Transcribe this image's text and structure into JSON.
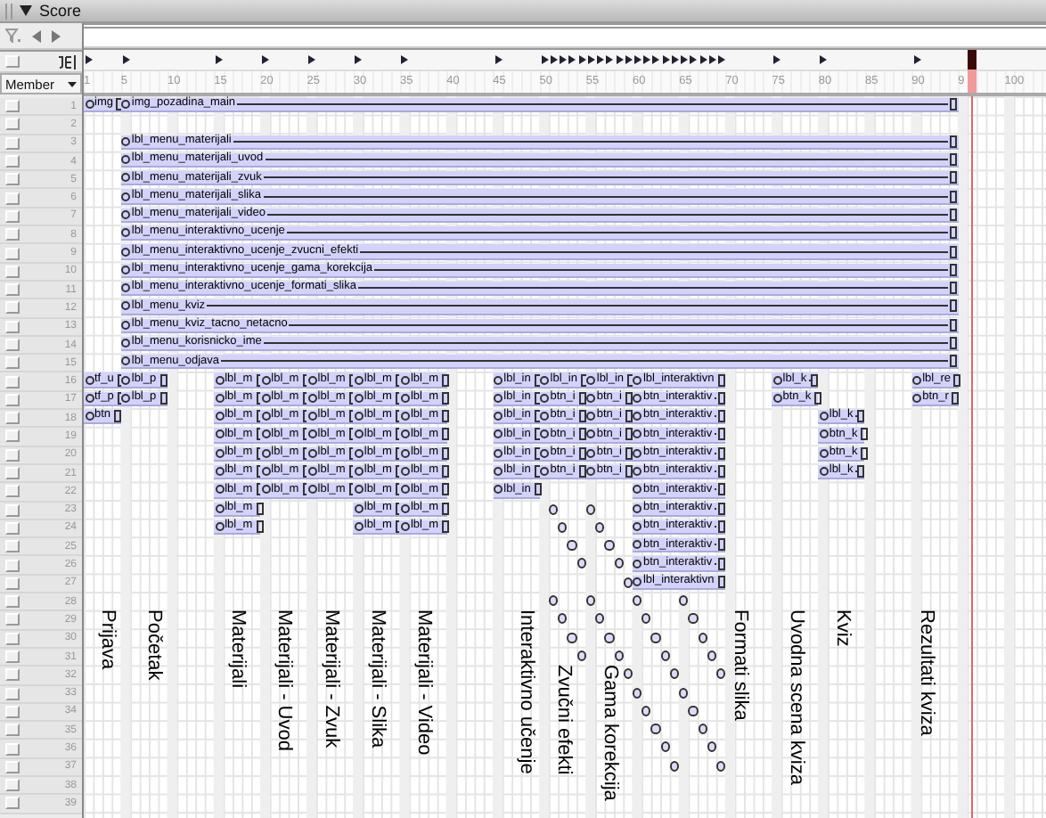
{
  "window": {
    "title": "Score"
  },
  "display_mode": "Member",
  "ruler": [
    "1",
    "5",
    "10",
    "15",
    "20",
    "25",
    "30",
    "35",
    "40",
    "45",
    "50",
    "55",
    "60",
    "65",
    "70",
    "75",
    "80",
    "85",
    "90",
    "9",
    "100"
  ],
  "channels": [
    {
      "number": "1",
      "sprites": [
        {
          "kind": "span",
          "label": "img"
        },
        {
          "kind": "span",
          "label": "img_pozadina_main"
        }
      ]
    },
    {
      "number": "2"
    },
    {
      "number": "3",
      "sprites": [
        {
          "kind": "span",
          "label": "lbl_menu_materijali"
        }
      ]
    },
    {
      "number": "4",
      "sprites": [
        {
          "kind": "span",
          "label": "lbl_menu_materijali_uvod"
        }
      ]
    },
    {
      "number": "5",
      "sprites": [
        {
          "kind": "span",
          "label": "lbl_menu_materijali_zvuk"
        }
      ]
    },
    {
      "number": "6",
      "sprites": [
        {
          "kind": "span",
          "label": "lbl_menu_materijali_slika"
        }
      ]
    },
    {
      "number": "7",
      "sprites": [
        {
          "kind": "span",
          "label": "lbl_menu_materijali_video"
        }
      ]
    },
    {
      "number": "8",
      "sprites": [
        {
          "kind": "span",
          "label": "lbl_menu_interaktivno_ucenje"
        }
      ]
    },
    {
      "number": "9",
      "sprites": [
        {
          "kind": "span",
          "label": "lbl_menu_interaktivno_ucenje_zvucni_efekti"
        }
      ]
    },
    {
      "number": "10",
      "sprites": [
        {
          "kind": "span",
          "label": "lbl_menu_interaktivno_ucenje_gama_korekcija"
        }
      ]
    },
    {
      "number": "11",
      "sprites": [
        {
          "kind": "span",
          "label": "lbl_menu_interaktivno_ucenje_formati_slika"
        }
      ]
    },
    {
      "number": "12",
      "sprites": [
        {
          "kind": "span",
          "label": "lbl_menu_kviz"
        }
      ]
    },
    {
      "number": "13",
      "sprites": [
        {
          "kind": "span",
          "label": "lbl_menu_kviz_tacno_netacno"
        }
      ]
    },
    {
      "number": "14",
      "sprites": [
        {
          "kind": "span",
          "label": "lbl_menu_korisnicko_ime"
        }
      ]
    },
    {
      "number": "15",
      "sprites": [
        {
          "kind": "span",
          "label": "lbl_menu_odjava"
        }
      ]
    },
    {
      "number": "16",
      "sprites": [
        {
          "kind": "span",
          "label": "tf_u"
        },
        {
          "kind": "span",
          "label": "lbl_p"
        },
        {
          "kind": "span",
          "label": "lbl_m"
        },
        {
          "kind": "span",
          "label": "lbl_m"
        },
        {
          "kind": "span",
          "label": "lbl_m"
        },
        {
          "kind": "span",
          "label": "lbl_m"
        },
        {
          "kind": "span",
          "label": "lbl_m"
        },
        {
          "kind": "span",
          "label": "lbl_in"
        },
        {
          "kind": "span",
          "label": "lbl_in"
        },
        {
          "kind": "span",
          "label": "lbl_in"
        },
        {
          "kind": "span",
          "label": "lbl_interaktivn"
        },
        {
          "kind": "span",
          "label": "lbl_k"
        },
        {
          "kind": "span",
          "label": "lbl_re"
        }
      ]
    },
    {
      "number": "17",
      "sprites": [
        {
          "kind": "span",
          "label": "tf_p"
        },
        {
          "kind": "span",
          "label": "lbl_p"
        },
        {
          "kind": "span",
          "label": "lbl_m"
        },
        {
          "kind": "span",
          "label": "lbl_m"
        },
        {
          "kind": "span",
          "label": "lbl_m"
        },
        {
          "kind": "span",
          "label": "lbl_m"
        },
        {
          "kind": "span",
          "label": "lbl_m"
        },
        {
          "kind": "span",
          "label": "lbl_in"
        },
        {
          "kind": "span",
          "label": "btn_i"
        },
        {
          "kind": "span",
          "label": "btn_i"
        },
        {
          "kind": "span",
          "label": "btn_interaktiv"
        },
        {
          "kind": "span",
          "label": "btn_k"
        },
        {
          "kind": "span",
          "label": "btn_r"
        }
      ]
    },
    {
      "number": "18",
      "sprites": [
        {
          "kind": "span",
          "label": "btn"
        },
        {
          "kind": "span",
          "label": "lbl_m"
        },
        {
          "kind": "span",
          "label": "lbl_m"
        },
        {
          "kind": "span",
          "label": "lbl_m"
        },
        {
          "kind": "span",
          "label": "lbl_m"
        },
        {
          "kind": "span",
          "label": "lbl_m"
        },
        {
          "kind": "span",
          "label": "lbl_in"
        },
        {
          "kind": "span",
          "label": "btn_i"
        },
        {
          "kind": "span",
          "label": "btn_i"
        },
        {
          "kind": "span",
          "label": "btn_interaktiv"
        },
        {
          "kind": "span",
          "label": "lbl_k"
        }
      ]
    },
    {
      "number": "19",
      "sprites": [
        {
          "kind": "span",
          "label": "lbl_m"
        },
        {
          "kind": "span",
          "label": "lbl_m"
        },
        {
          "kind": "span",
          "label": "lbl_m"
        },
        {
          "kind": "span",
          "label": "lbl_m"
        },
        {
          "kind": "span",
          "label": "lbl_m"
        },
        {
          "kind": "span",
          "label": "lbl_in"
        },
        {
          "kind": "span",
          "label": "btn_i"
        },
        {
          "kind": "span",
          "label": "btn_i"
        },
        {
          "kind": "span",
          "label": "btn_interaktiv"
        },
        {
          "kind": "span",
          "label": "btn_k"
        }
      ]
    },
    {
      "number": "20",
      "sprites": [
        {
          "kind": "span",
          "label": "lbl_m"
        },
        {
          "kind": "span",
          "label": "lbl_m"
        },
        {
          "kind": "span",
          "label": "lbl_m"
        },
        {
          "kind": "span",
          "label": "lbl_m"
        },
        {
          "kind": "span",
          "label": "lbl_m"
        },
        {
          "kind": "span",
          "label": "lbl_in"
        },
        {
          "kind": "span",
          "label": "btn_i"
        },
        {
          "kind": "span",
          "label": "btn_i"
        },
        {
          "kind": "span",
          "label": "btn_interaktiv"
        },
        {
          "kind": "span",
          "label": "btn_k"
        }
      ]
    },
    {
      "number": "21",
      "sprites": [
        {
          "kind": "span",
          "label": "lbl_m"
        },
        {
          "kind": "span",
          "label": "lbl_m"
        },
        {
          "kind": "span",
          "label": "lbl_m"
        },
        {
          "kind": "span",
          "label": "lbl_m"
        },
        {
          "kind": "span",
          "label": "lbl_m"
        },
        {
          "kind": "span",
          "label": "lbl_in"
        },
        {
          "kind": "span",
          "label": "btn_i"
        },
        {
          "kind": "span",
          "label": "btn_i"
        },
        {
          "kind": "span",
          "label": "btn_interaktiv"
        },
        {
          "kind": "span",
          "label": "lbl_k"
        }
      ]
    },
    {
      "number": "22",
      "sprites": [
        {
          "kind": "span",
          "label": "lbl_m"
        },
        {
          "kind": "span",
          "label": "lbl_m"
        },
        {
          "kind": "span",
          "label": "lbl_m"
        },
        {
          "kind": "span",
          "label": "lbl_m"
        },
        {
          "kind": "span",
          "label": "lbl_m"
        },
        {
          "kind": "span",
          "label": "lbl_in"
        },
        {
          "kind": "span",
          "label": "btn_interaktiv"
        }
      ]
    },
    {
      "number": "23",
      "sprites": [
        {
          "kind": "span",
          "label": "lbl_m"
        },
        {
          "kind": "span",
          "label": "lbl_m"
        },
        {
          "kind": "span",
          "label": "lbl_m"
        },
        {
          "kind": "dot"
        },
        {
          "kind": "dot"
        },
        {
          "kind": "span",
          "label": "btn_interaktiv"
        }
      ]
    },
    {
      "number": "24",
      "sprites": [
        {
          "kind": "span",
          "label": "lbl_m"
        },
        {
          "kind": "span",
          "label": "lbl_m"
        },
        {
          "kind": "span",
          "label": "lbl_m"
        },
        {
          "kind": "dot"
        },
        {
          "kind": "dot"
        },
        {
          "kind": "span",
          "label": "btn_interaktiv"
        }
      ]
    },
    {
      "number": "25",
      "sprites": [
        {
          "kind": "dot"
        },
        {
          "kind": "dot"
        },
        {
          "kind": "span",
          "label": "btn_interaktiv"
        }
      ]
    },
    {
      "number": "26",
      "sprites": [
        {
          "kind": "dot"
        },
        {
          "kind": "dot"
        },
        {
          "kind": "span",
          "label": "btn_interaktiv"
        }
      ]
    },
    {
      "number": "27",
      "sprites": [
        {
          "kind": "dot"
        },
        {
          "kind": "span",
          "label": "lbl_interaktivn"
        }
      ]
    },
    {
      "number": "28",
      "sprites": [
        {
          "kind": "dot"
        },
        {
          "kind": "dot"
        },
        {
          "kind": "dot"
        },
        {
          "kind": "dot"
        }
      ]
    },
    {
      "number": "29",
      "sprites": [
        {
          "kind": "dot"
        },
        {
          "kind": "dot"
        },
        {
          "kind": "dot"
        },
        {
          "kind": "dot"
        }
      ]
    },
    {
      "number": "30",
      "sprites": [
        {
          "kind": "dot"
        },
        {
          "kind": "dot"
        },
        {
          "kind": "dot"
        },
        {
          "kind": "dot"
        }
      ]
    },
    {
      "number": "31",
      "sprites": [
        {
          "kind": "dot"
        },
        {
          "kind": "dot"
        },
        {
          "kind": "dot"
        },
        {
          "kind": "dot"
        }
      ]
    },
    {
      "number": "32",
      "sprites": [
        {
          "kind": "dot"
        },
        {
          "kind": "dot"
        },
        {
          "kind": "dot"
        }
      ]
    },
    {
      "number": "33",
      "sprites": [
        {
          "kind": "dot"
        },
        {
          "kind": "dot"
        }
      ]
    },
    {
      "number": "34",
      "sprites": [
        {
          "kind": "dot"
        },
        {
          "kind": "dot"
        }
      ]
    },
    {
      "number": "35",
      "sprites": [
        {
          "kind": "dot"
        },
        {
          "kind": "dot"
        }
      ]
    },
    {
      "number": "36",
      "sprites": [
        {
          "kind": "dot"
        },
        {
          "kind": "dot"
        }
      ]
    },
    {
      "number": "37",
      "sprites": [
        {
          "kind": "dot"
        },
        {
          "kind": "dot"
        }
      ]
    },
    {
      "number": "38"
    },
    {
      "number": "39"
    }
  ],
  "annotations": [
    "Prijava",
    "Početak",
    "Materijali",
    "Materijali - Uvod",
    "Materijali - Zvuk",
    "Materijali - Slika",
    "Materijali - Video",
    "Interaktivno učenje",
    "Zvučni efekti",
    "Gama korekcija",
    "Formati slika",
    "Uvodna scena kviza",
    "Kviz",
    "Rezultati kviza"
  ]
}
